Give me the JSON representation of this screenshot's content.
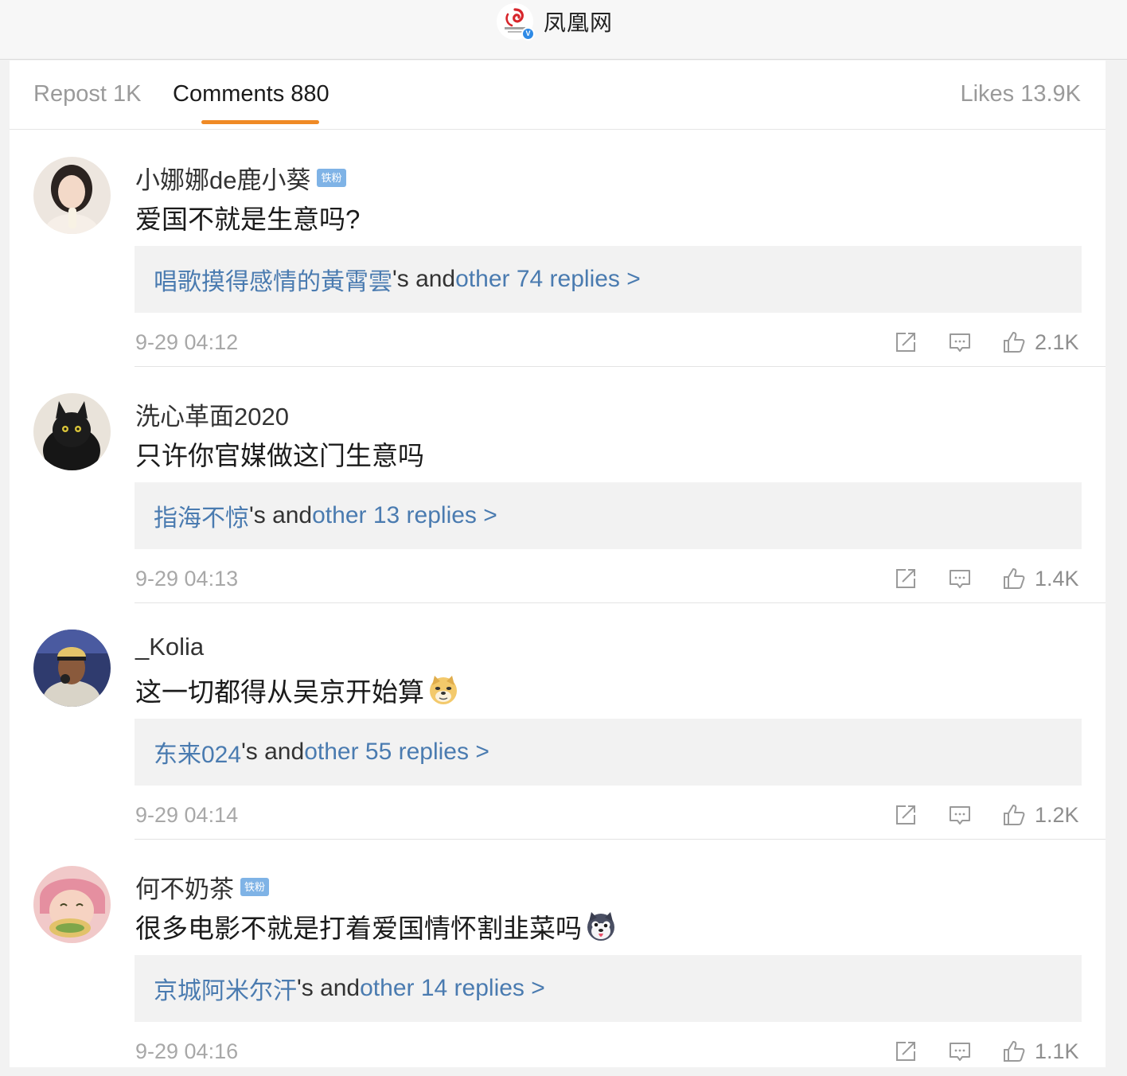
{
  "header": {
    "account_name": "凤凰网",
    "logo_text": "凤凰网",
    "verified_mark": "V"
  },
  "tabs": {
    "repost": "Repost 1K",
    "comments": "Comments 880",
    "likes": "Likes 13.9K"
  },
  "reply_connector": "'s and ",
  "comments": [
    {
      "username": "小娜娜de鹿小葵",
      "badge": "铁粉",
      "text": "爱国不就是生意吗?",
      "emoji": "",
      "reply_user": "唱歌摸得感情的黃霄雲",
      "reply_count": "other 74 replies >",
      "time": "9-29 04:12",
      "likes": "2.1K"
    },
    {
      "username": "洗心革面2020",
      "badge": "",
      "text": "只许你官媒做这门生意吗",
      "emoji": "",
      "reply_user": "指海不惊",
      "reply_count": "other 13 replies >",
      "time": "9-29 04:13",
      "likes": "1.4K"
    },
    {
      "username": "_Kolia",
      "badge": "",
      "text": "这一切都得从吴京开始算",
      "emoji": "doge-emoji",
      "reply_user": "东来024",
      "reply_count": "other 55 replies >",
      "time": "9-29 04:14",
      "likes": "1.2K"
    },
    {
      "username": "何不奶茶",
      "badge": "铁粉",
      "text": "很多电影不就是打着爱国情怀割韭菜吗",
      "emoji": "husky-emoji",
      "reply_user": "京城阿米尔汗",
      "reply_count": "other 14 replies >",
      "time": "9-29 04:16",
      "likes": "1.1K"
    }
  ],
  "colors": {
    "accent_underline": "#ef8a25",
    "link_blue": "#4a7bb0",
    "badge_blue": "#7fb3e6"
  }
}
